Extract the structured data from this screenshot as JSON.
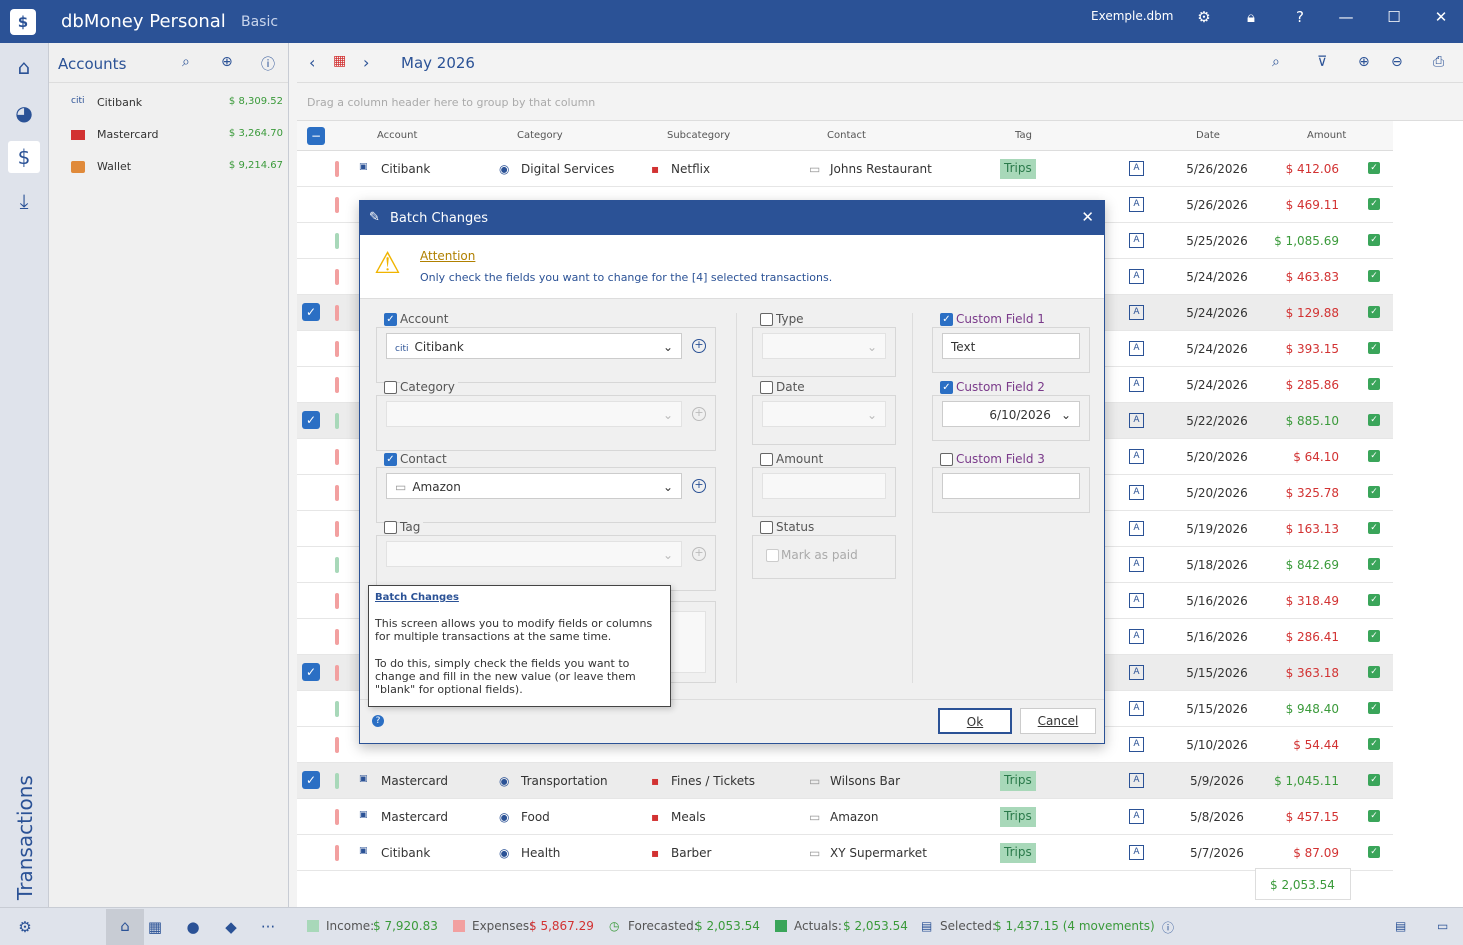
{
  "app": {
    "name": "dbMoney Personal",
    "edition": "Basic",
    "file": "Exemple.dbm"
  },
  "sidebar": {
    "vertical_label": "Transactions"
  },
  "accounts": {
    "title": "Accounts",
    "items": [
      {
        "name": "Citibank",
        "balance": "$ 8,309.52",
        "icon": "citi-icon"
      },
      {
        "name": "Mastercard",
        "balance": "$ 3,264.70",
        "icon": "mastercard-icon"
      },
      {
        "name": "Wallet",
        "balance": "$ 9,214.67",
        "icon": "wallet-icon"
      }
    ]
  },
  "toolbar": {
    "month": "May 2026"
  },
  "grid": {
    "group_hint": "Drag a column header here to group by that column",
    "headers": {
      "account": "Account",
      "category": "Category",
      "subcategory": "Subcategory",
      "contact": "Contact",
      "tag": "Tag",
      "date": "Date",
      "amount": "Amount"
    },
    "rows": [
      {
        "account": "Citibank",
        "category": "Digital Services",
        "subcategory": "Netflix",
        "contact": "Johns Restaurant",
        "tag": "Trips",
        "date": "5/26/2026",
        "amount": "$ 412.06",
        "type": "expense",
        "checked": false
      },
      {
        "account": "",
        "category": "",
        "subcategory": "",
        "contact": "",
        "tag": "",
        "date": "5/26/2026",
        "amount": "$ 469.11",
        "type": "expense",
        "checked": false
      },
      {
        "account": "",
        "category": "",
        "subcategory": "",
        "contact": "",
        "tag": "",
        "date": "5/25/2026",
        "amount": "$ 1,085.69",
        "type": "income",
        "checked": false
      },
      {
        "account": "",
        "category": "",
        "subcategory": "",
        "contact": "",
        "tag": "",
        "date": "5/24/2026",
        "amount": "$ 463.83",
        "type": "expense",
        "checked": false
      },
      {
        "account": "",
        "category": "",
        "subcategory": "",
        "contact": "",
        "tag": "",
        "date": "5/24/2026",
        "amount": "$ 129.88",
        "type": "expense",
        "checked": true
      },
      {
        "account": "",
        "category": "",
        "subcategory": "",
        "contact": "",
        "tag": "",
        "date": "5/24/2026",
        "amount": "$ 393.15",
        "type": "expense",
        "checked": false
      },
      {
        "account": "",
        "category": "",
        "subcategory": "",
        "contact": "",
        "tag": "",
        "date": "5/24/2026",
        "amount": "$ 285.86",
        "type": "expense",
        "checked": false
      },
      {
        "account": "",
        "category": "",
        "subcategory": "",
        "contact": "",
        "tag": "",
        "date": "5/22/2026",
        "amount": "$ 885.10",
        "type": "income",
        "checked": true
      },
      {
        "account": "",
        "category": "",
        "subcategory": "",
        "contact": "",
        "tag": "",
        "date": "5/20/2026",
        "amount": "$ 64.10",
        "type": "expense",
        "checked": false
      },
      {
        "account": "",
        "category": "",
        "subcategory": "",
        "contact": "",
        "tag": "",
        "date": "5/20/2026",
        "amount": "$ 325.78",
        "type": "expense",
        "checked": false
      },
      {
        "account": "",
        "category": "",
        "subcategory": "",
        "contact": "",
        "tag": "",
        "date": "5/19/2026",
        "amount": "$ 163.13",
        "type": "expense",
        "checked": false
      },
      {
        "account": "",
        "category": "",
        "subcategory": "",
        "contact": "",
        "tag": "",
        "date": "5/18/2026",
        "amount": "$ 842.69",
        "type": "income",
        "checked": false
      },
      {
        "account": "",
        "category": "",
        "subcategory": "",
        "contact": "",
        "tag": "",
        "date": "5/16/2026",
        "amount": "$ 318.49",
        "type": "expense",
        "checked": false
      },
      {
        "account": "",
        "category": "",
        "subcategory": "",
        "contact": "",
        "tag": "",
        "date": "5/16/2026",
        "amount": "$ 286.41",
        "type": "expense",
        "checked": false
      },
      {
        "account": "",
        "category": "",
        "subcategory": "",
        "contact": "",
        "tag": "",
        "date": "5/15/2026",
        "amount": "$ 363.18",
        "type": "expense",
        "checked": true
      },
      {
        "account": "",
        "category": "",
        "subcategory": "",
        "contact": "",
        "tag": "",
        "date": "5/15/2026",
        "amount": "$ 948.40",
        "type": "income",
        "checked": false
      },
      {
        "account": "",
        "category": "",
        "subcategory": "",
        "contact": "",
        "tag": "",
        "date": "5/10/2026",
        "amount": "$ 54.44",
        "type": "expense",
        "checked": false
      },
      {
        "account": "Mastercard",
        "category": "Transportation",
        "subcategory": "Fines / Tickets",
        "contact": "Wilsons Bar",
        "tag": "Trips",
        "date": "5/9/2026",
        "amount": "$ 1,045.11",
        "type": "income",
        "checked": true
      },
      {
        "account": "Mastercard",
        "category": "Food",
        "subcategory": "Meals",
        "contact": "Amazon",
        "tag": "Trips",
        "date": "5/8/2026",
        "amount": "$ 457.15",
        "type": "expense",
        "checked": false
      },
      {
        "account": "Citibank",
        "category": "Health",
        "subcategory": "Barber",
        "contact": "XY Supermarket",
        "tag": "Trips",
        "date": "5/7/2026",
        "amount": "$ 87.09",
        "type": "expense",
        "checked": false
      }
    ],
    "total": "$ 2,053.54"
  },
  "dialog": {
    "title": "Batch Changes",
    "attention_title": "Attention",
    "attention_text": "Only check the fields you want to change for the [4] selected transactions.",
    "account_label": "Account",
    "account_value": "Citibank",
    "category_label": "Category",
    "contact_label": "Contact",
    "contact_value": "Amazon",
    "tag_label": "Tag",
    "type_label": "Type",
    "date_label": "Date",
    "amount_label": "Amount",
    "status_label": "Status",
    "mark_paid": "Mark as paid",
    "cf1_label": "Custom Field 1",
    "cf1_value": "Text",
    "cf2_label": "Custom Field 2",
    "cf2_value": "6/10/2026",
    "cf3_label": "Custom Field 3",
    "ok": "Ok",
    "cancel": "Cancel"
  },
  "tooltip": {
    "title": "Batch Changes",
    "p1": "This screen allows you to modify fields or columns for multiple transactions at the same time.",
    "p2": "To do this, simply check the fields you want to change and fill in the new value (or leave them \"blank\" for optional fields)."
  },
  "status": {
    "income_label": "Income:",
    "income": "$ 7,920.83",
    "expenses_label": "Expenses:",
    "expenses": "$ 5,867.29",
    "forecasted_label": "Forecasted:",
    "forecasted": "$ 2,053.54",
    "actuals_label": "Actuals:",
    "actuals": "$ 2,053.54",
    "selected_label": "Selected:",
    "selected": "$ 1,437.15 (4 movements)"
  },
  "colors": {
    "brand": "#2b5296",
    "income": "#3a9a3a",
    "expense": "#d23232",
    "tag": "#a8d8b9"
  }
}
